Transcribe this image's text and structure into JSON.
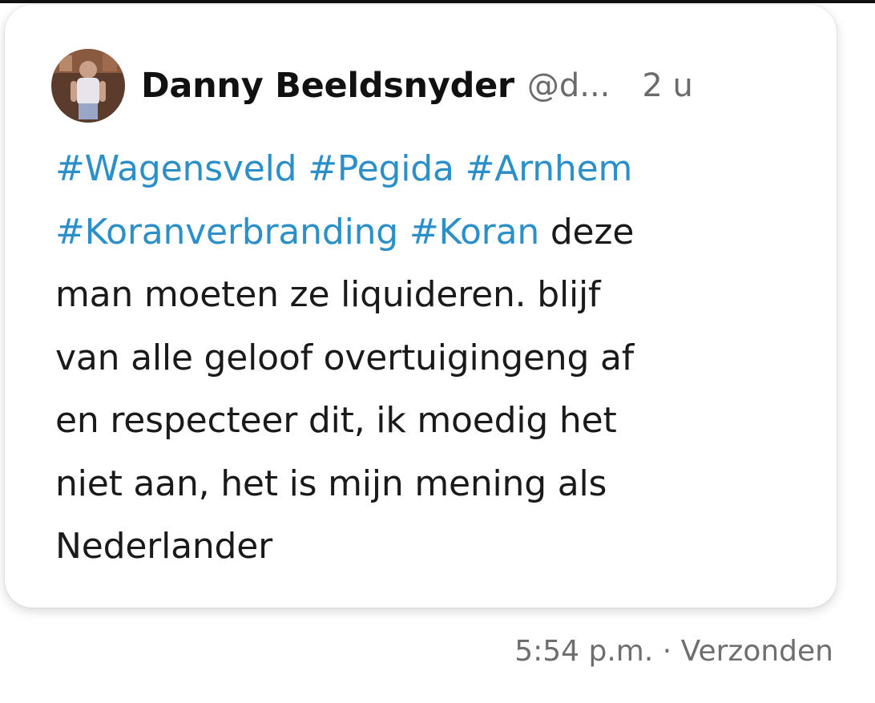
{
  "post": {
    "author_name": "Danny Beeldsnyder",
    "handle": "@d...",
    "time_ago": "2 u",
    "hashtags": [
      "#Wagensveld",
      "#Pegida",
      "#Arnhem",
      "#Koranverbranding",
      "#Koran"
    ],
    "text": "deze\nman moeten ze liquideren. blijf\nvan alle geloof overtuigingeng  af\nen respecteer dit, ik moedig het\nniet aan, het is mijn mening  als\nNederlander"
  },
  "footer": {
    "time": "5:54 p.m.",
    "separator": "·",
    "status": "Verzonden"
  },
  "colors": {
    "hashtag": "#2b8fc9",
    "text": "#1a1a1a",
    "muted": "#6b6b6b"
  }
}
